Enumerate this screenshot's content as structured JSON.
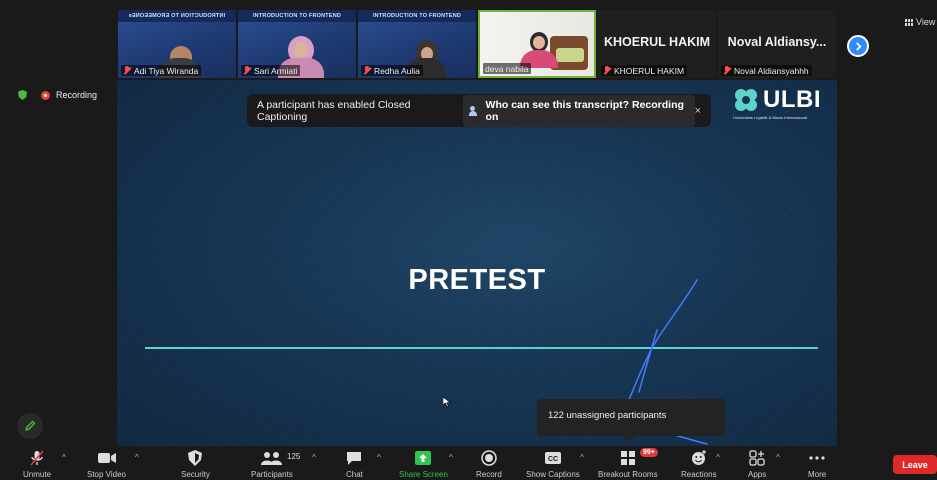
{
  "gallery": {
    "tiles": [
      {
        "slide_header": "ɘƎИOƎƎMOЯƎ OT ИOITƆUDOЯƬИI",
        "name": "Adi Tiya Wiranda"
      },
      {
        "slide_header": "INTRODUCTION TO FRONTEND",
        "name": "Sari Armiati"
      },
      {
        "slide_header": "INTRODUCTION TO FRONTEND",
        "name": "Redha Aulia"
      },
      {
        "slide_header": "",
        "name": "deva nabila"
      },
      {
        "display_name": "KHOERUL HAKIM",
        "name": "KHOERUL HAKIM"
      },
      {
        "display_name": "Noval  Aldiansy...",
        "name": "Noval Aldiansyahhh"
      }
    ],
    "view_label": "View"
  },
  "status": {
    "recording_label": "Recording"
  },
  "banner": {
    "message": "A participant has enabled Closed Captioning",
    "link": "Who can see this transcript? Recording on",
    "close": "×"
  },
  "slide": {
    "title": "PRETEST",
    "logo_word": "ULBI",
    "logo_tagline": "Universitas Logistik & Bisnis Internasional"
  },
  "tooltip": {
    "text": "122 unassigned participants"
  },
  "toolbar": {
    "unmute": "Unmute",
    "stop_video": "Stop Video",
    "security": "Security",
    "participants": "Participants",
    "participants_count": "125",
    "chat": "Chat",
    "share_screen": "Share Screen",
    "record": "Record",
    "show_captions": "Show Captions",
    "breakout_rooms": "Breakout Rooms",
    "breakout_badge": "99+",
    "reactions": "Reactions",
    "apps": "Apps",
    "more": "More",
    "leave": "Leave"
  },
  "colors": {
    "accent": "#2d8cff",
    "share": "#2ec54f",
    "leave": "#e02828",
    "slide_line": "#5fd3c9"
  }
}
